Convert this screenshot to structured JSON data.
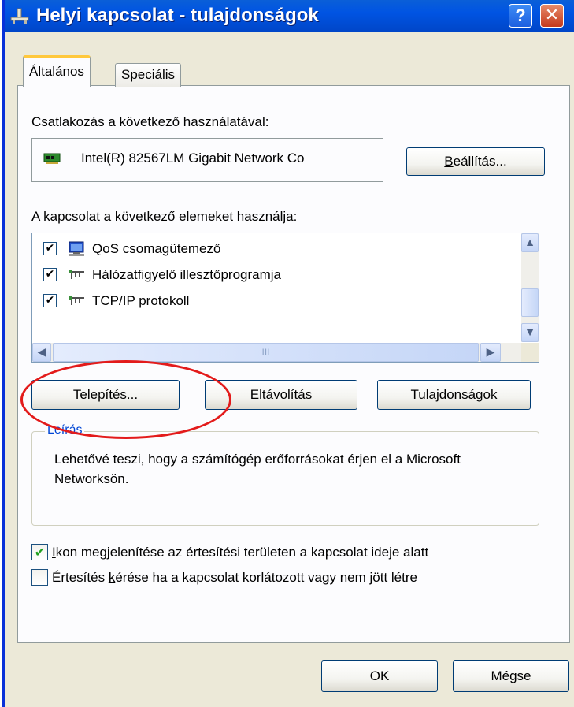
{
  "window": {
    "title": "Helyi kapcsolat - tulajdonságok",
    "help_glyph": "?",
    "close_glyph": "✕"
  },
  "tabs": [
    {
      "label": "Általános",
      "active": true
    },
    {
      "label": "Speciális",
      "active": false
    }
  ],
  "connect": {
    "label": "Csatlakozás a következő használatával:",
    "adapter_name": "Intel(R) 82567LM Gigabit Network Co",
    "config_button": {
      "pre": "",
      "accel": "B",
      "post": "eállítás..."
    }
  },
  "components": {
    "label": "A kapcsolat a következő elemeket használja:",
    "items": [
      {
        "checked": true,
        "icon": "qos-scheduler-icon",
        "text": "QoS csomagütemező"
      },
      {
        "checked": true,
        "icon": "network-monitor-icon",
        "text": "Hálózatfigyelő illesztőprogramja"
      },
      {
        "checked": true,
        "icon": "protocol-icon",
        "text": "TCP/IP protokoll"
      }
    ],
    "check_glyph": "✔",
    "scroll": {
      "up": "▲",
      "down": "▼",
      "left": "◀",
      "right": "▶",
      "grip": "III"
    }
  },
  "buttons": {
    "install": {
      "pre": "Tele",
      "accel": "p",
      "post": "ítés..."
    },
    "uninstall": {
      "pre": "",
      "accel": "E",
      "post": "ltávolítás"
    },
    "properties": {
      "pre": "T",
      "accel": "u",
      "post": "lajdonságok"
    }
  },
  "description": {
    "title": "Leírás",
    "text": "Lehetővé teszi, hogy a számítógép erőforrásokat érjen el a Microsoft Networksön."
  },
  "options": [
    {
      "checked": true,
      "accel": "I",
      "rest": "kon megjelenítése az értesítési területen a kapcsolat ideje alatt"
    },
    {
      "checked": false,
      "pre": "Értesítés ",
      "accel": "k",
      "rest": "érése ha a kapcsolat korlátozott vagy nem jött létre"
    }
  ],
  "footer": {
    "ok": "OK",
    "cancel": "Mégse"
  },
  "annotation": {
    "color": "#e31b1b",
    "target": "install-button"
  },
  "colors": {
    "titlebar": "#0054e3",
    "tab_highlight": "#ffc83c",
    "face": "#ece9d8",
    "check_green": "#21a121"
  }
}
